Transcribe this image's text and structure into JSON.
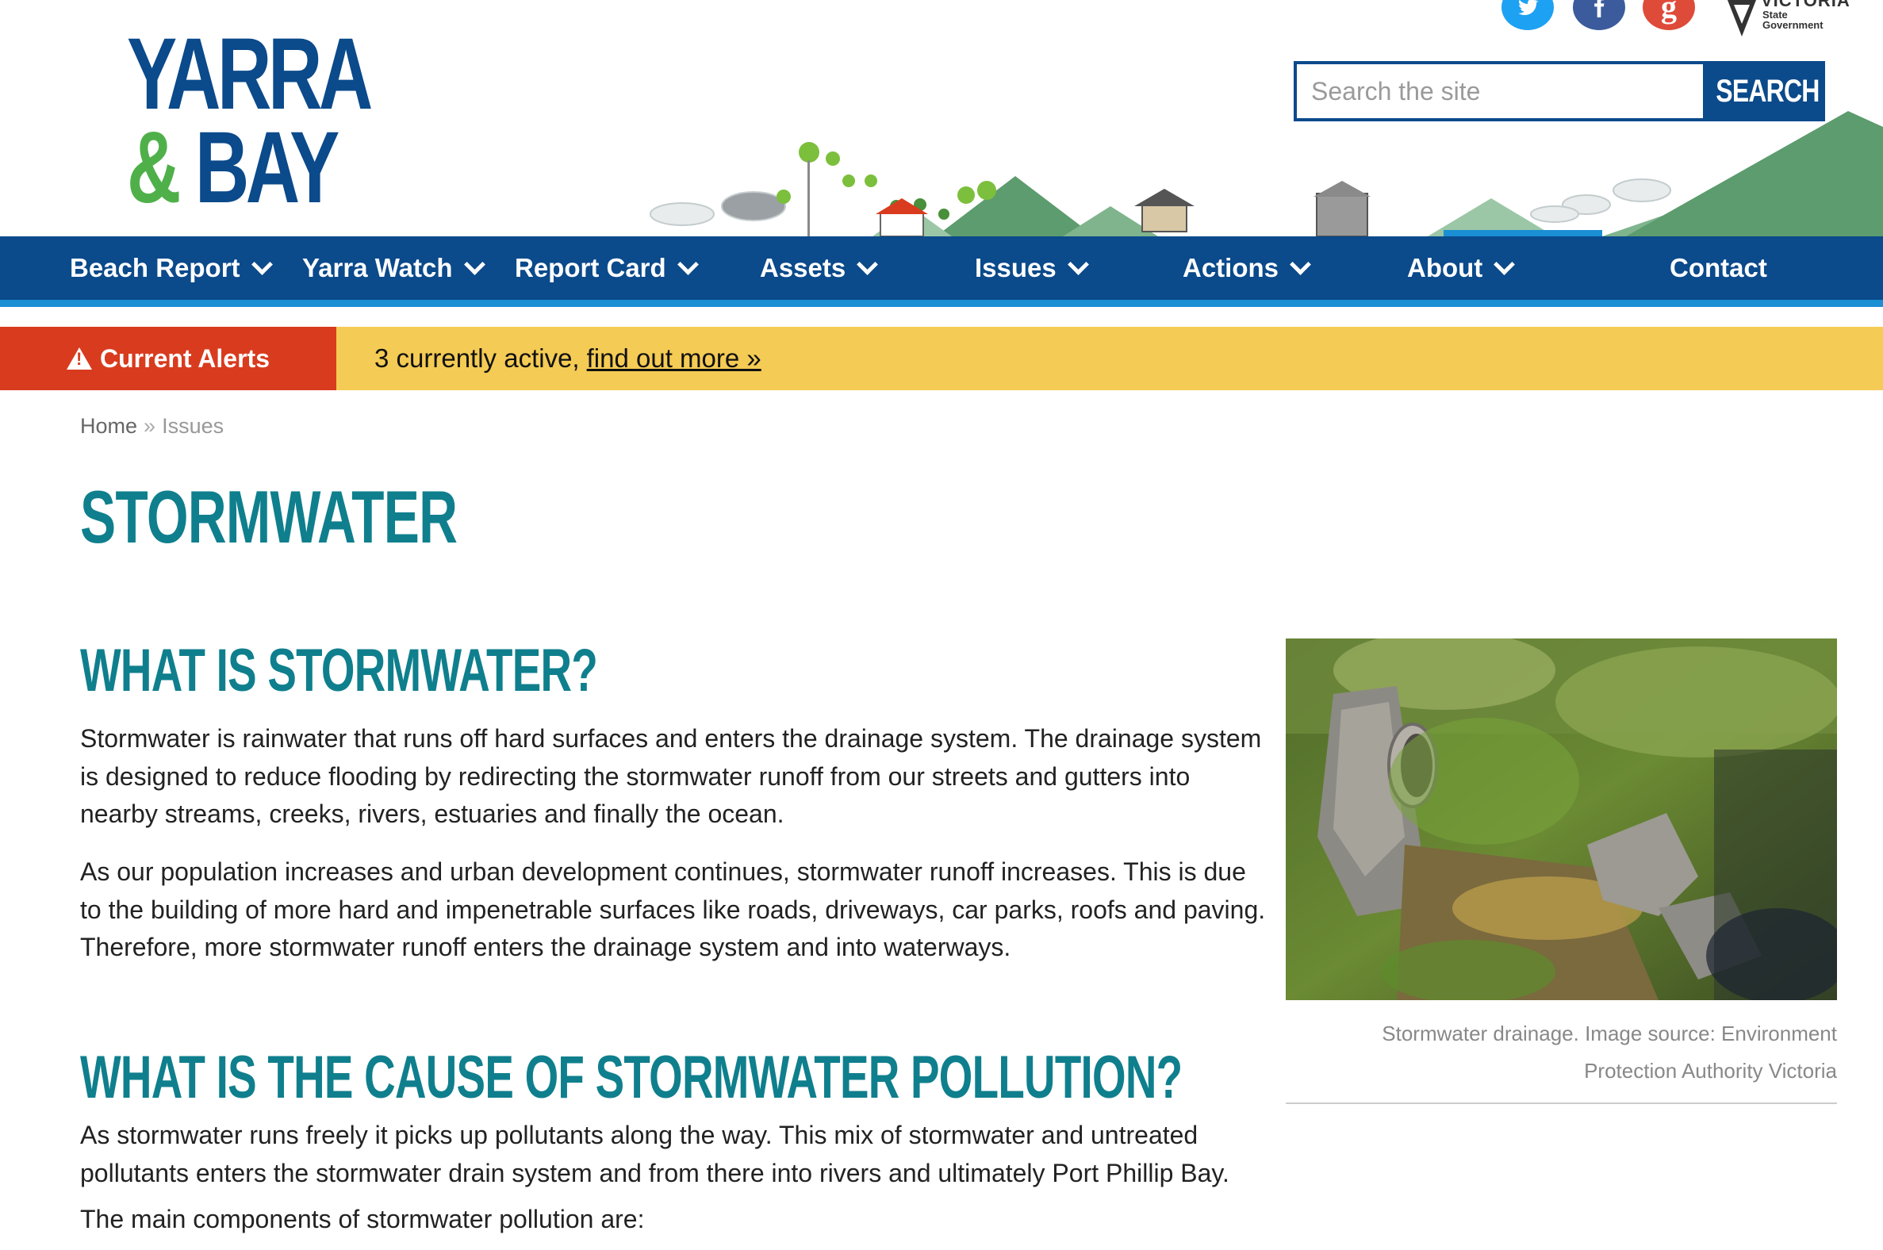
{
  "brand": {
    "line1": "YARRA",
    "amp": "&",
    "line2": "BAY"
  },
  "social": [
    {
      "name": "twitter",
      "glyph": "t"
    },
    {
      "name": "facebook",
      "glyph": "f"
    },
    {
      "name": "google",
      "glyph": "g"
    }
  ],
  "government": {
    "title": "VICTORIA",
    "sub1": "State",
    "sub2": "Government"
  },
  "search": {
    "placeholder": "Search the site",
    "button_label": "SEARCH"
  },
  "nav": {
    "items": [
      {
        "label": "Beach Report",
        "has_dropdown": true
      },
      {
        "label": "Yarra Watch",
        "has_dropdown": true
      },
      {
        "label": "Report Card",
        "has_dropdown": true
      },
      {
        "label": "Assets",
        "has_dropdown": true
      },
      {
        "label": "Issues",
        "has_dropdown": true
      },
      {
        "label": "Actions",
        "has_dropdown": true
      },
      {
        "label": "About",
        "has_dropdown": true
      },
      {
        "label": "Contact",
        "has_dropdown": false
      }
    ]
  },
  "alert": {
    "label": "Current Alerts",
    "text": "3 currently active,",
    "link": "find out more »"
  },
  "breadcrumb": {
    "home": "Home",
    "separator": "»",
    "current": "Issues"
  },
  "page": {
    "title": "STORMWATER",
    "sections": [
      {
        "heading": "WHAT IS STORMWATER?",
        "paragraphs": [
          "Stormwater is rainwater that runs off hard surfaces and enters the drainage system. The drainage system is designed to reduce flooding by redirecting the stormwater runoff from our streets and gutters into nearby streams, creeks, rivers, estuaries and finally the ocean.",
          "As our population increases and urban development continues, stormwater runoff increases. This is due to the building of more hard and impenetrable surfaces like roads, driveways, car parks, roofs and paving. Therefore, more stormwater runoff enters the drainage system and into waterways."
        ]
      },
      {
        "heading": "WHAT IS THE CAUSE OF STORMWATER POLLUTION?",
        "paragraphs": [
          "As stormwater runs freely it picks up pollutants along the way. This mix of stormwater and untreated pollutants enters the stormwater drain system and from there into rivers and ultimately Port Phillip Bay.",
          "The main components of stormwater pollution are:"
        ]
      }
    ]
  },
  "figure": {
    "caption": "Stormwater drainage. Image source: Environment Protection Authority Victoria"
  },
  "colors": {
    "brand_blue": "#0b4a8b",
    "brand_green": "#4fb04a",
    "heading_teal": "#0f7f8d",
    "nav_underline": "#1a8fd4",
    "alert_red": "#d93b1e",
    "alert_yellow": "#f4cb54"
  }
}
